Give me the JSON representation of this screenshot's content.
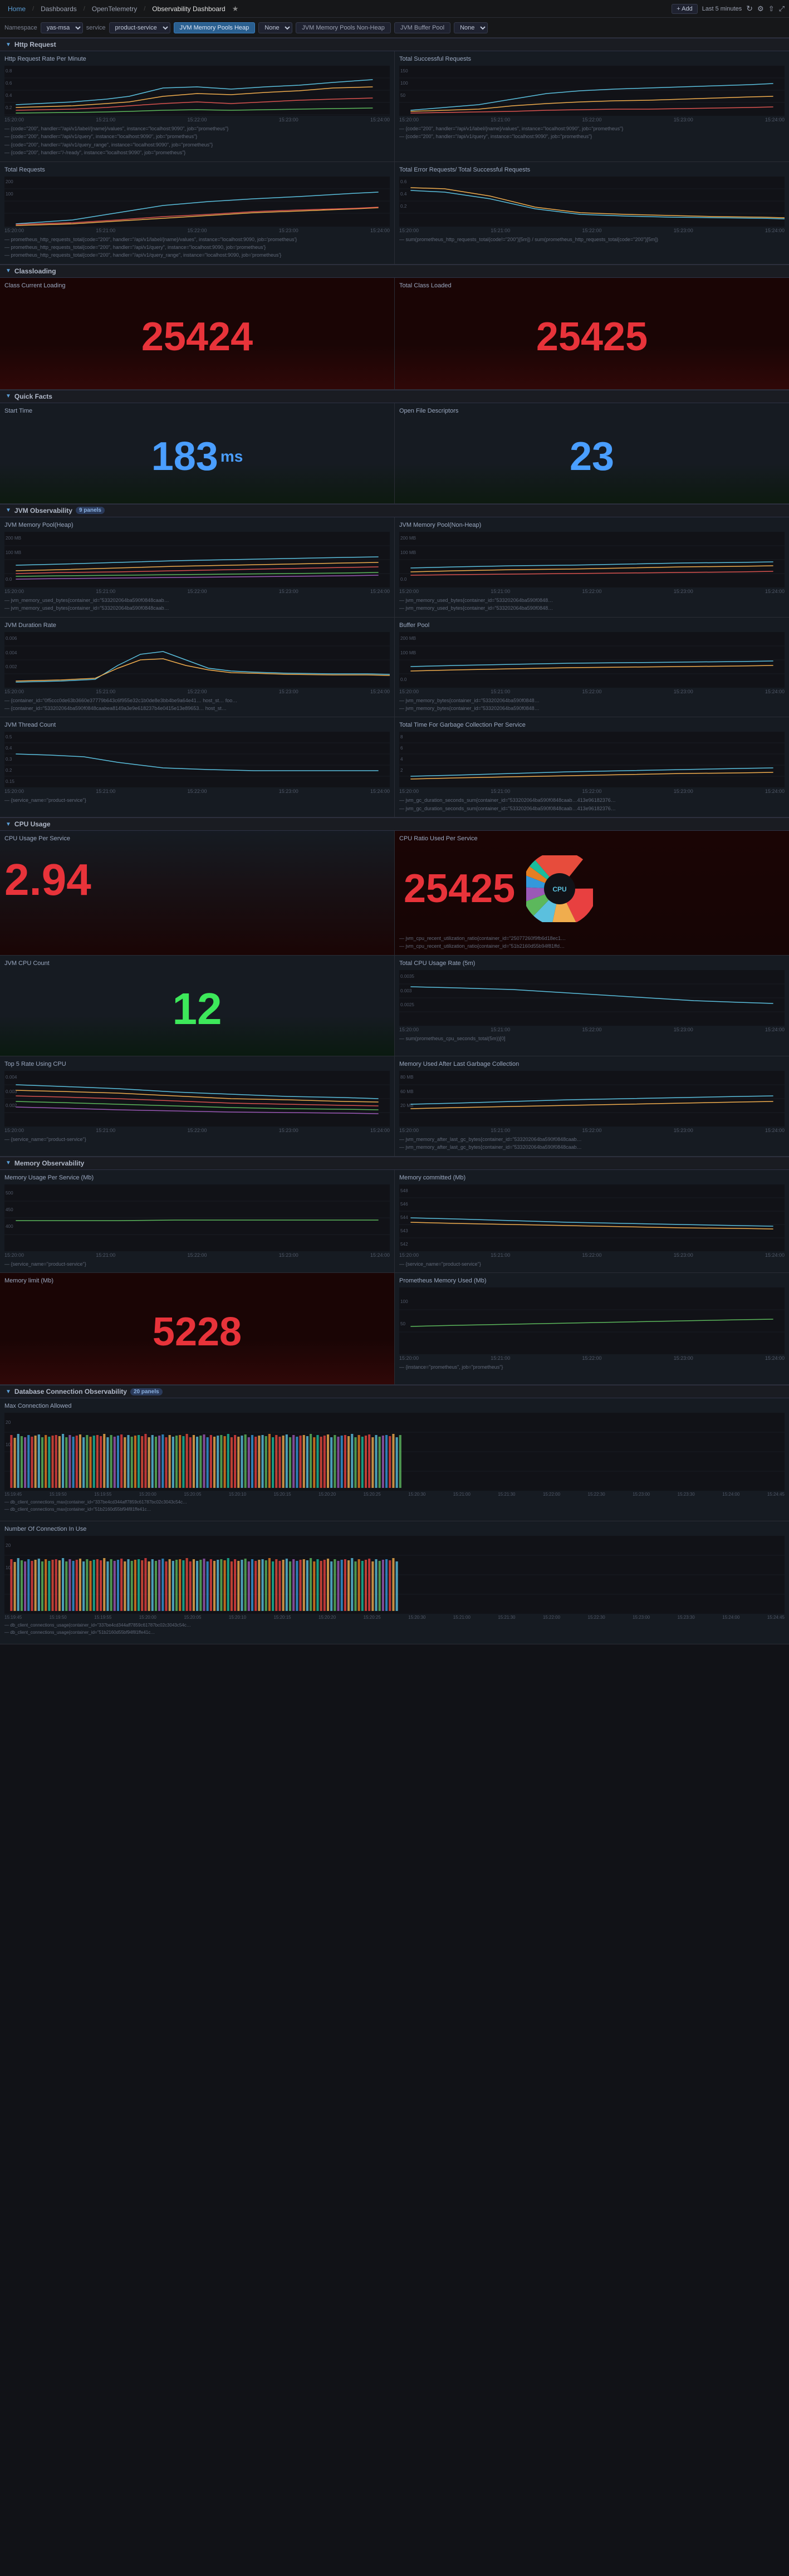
{
  "nav": {
    "home_label": "Home",
    "dashboards_label": "Dashboards",
    "opentelemetry_label": "OpenTelemetry",
    "observability_label": "Observability Dashboard",
    "starred_icon": "★",
    "add_button": "+ Add",
    "last_label": "Last 5 minutes",
    "refresh_icon": "↻",
    "settings_icon": "⚙",
    "share_icon": "⇧",
    "expand_icon": "⤢"
  },
  "toolbar": {
    "namespace_label": "Namespace",
    "namespace_value": "yas-msa ▾",
    "service_label": "service",
    "service_value": "product-service ▾",
    "jvm_heap_tab": "JVM Memory Pools Heap",
    "none1_value": "None ▾",
    "jvm_nonheap_tab": "JVM Memory Pools Non-Heap",
    "buffer_tab": "JVM Buffer Pool",
    "none2_value": "None ▾"
  },
  "sections": {
    "http_request": "Http Request",
    "classloading": "Classloading",
    "quick_facts": "Quick Facts",
    "jvm_observability": "JVM Observability",
    "jvm_count": "9 panels",
    "cpu_usage": "CPU Usage",
    "memory_observability": "Memory Observability",
    "database_connection": "Database Connection Observability",
    "db_count": "20 panels"
  },
  "http_request": {
    "rate_title": "Http Request Rate Per Minute",
    "successful_title": "Total Successful Requests",
    "total_title": "Total Requests",
    "error_title": "Total Error Requests/ Total Successful Requests",
    "y_axis_rate": [
      "0.8",
      "0.6",
      "0.4",
      "0.2"
    ],
    "y_axis_success": [
      "150",
      "100",
      "50"
    ],
    "x_axis_times": [
      "15:20:00",
      "15:21:00",
      "15:22:00",
      "15:23:00",
      "15:24:00"
    ],
    "legend_rate": [
      {
        "color": "#5bc0de",
        "text": "{code='200', handler='/api/v1/label/{name}/values', instance='localhost:9090', job='prometheus'}"
      },
      {
        "color": "#f0ad4e",
        "text": "{code='200', handler='/api/v1/query', instance='localhost:9090', job='prometheus'}"
      },
      {
        "color": "#d9534f",
        "text": "{code='200', handler='/api/v1/query_range', instance='localhost:9090', job='prometheus'}"
      }
    ]
  },
  "classloading": {
    "current_title": "Class Current Loading",
    "total_title": "Total Class Loaded",
    "current_value": "25424",
    "total_value": "25425"
  },
  "quick_facts": {
    "start_title": "Start Time",
    "start_value": "183",
    "start_unit": " ms",
    "open_fd_title": "Open File Descriptors",
    "open_fd_value": "23"
  },
  "jvm_observability": {
    "heap_title": "JVM Memory Pool(Heap)",
    "non_heap_title": "JVM Memory Pool(Non-Heap)",
    "duration_title": "JVM Duration Rate",
    "buffer_title": "Buffer Pool",
    "thread_title": "JVM Thread Count",
    "gc_title": "Total Time For Garbage Collection Per Service",
    "y_heap": [
      "200 MB",
      "100 MB",
      "0.0"
    ],
    "y_nonheap": [
      "200 MB",
      "100 MB",
      "0.0"
    ],
    "y_duration": [
      "0.006",
      "0.004",
      "0.002"
    ],
    "y_buffer": [
      "200 MB",
      "100 MB",
      "0.0"
    ],
    "y_thread": [
      "0.5",
      "0.4",
      "0.3",
      "0.2",
      "0.15"
    ],
    "y_gc": [
      "8",
      "6",
      "4",
      "2"
    ]
  },
  "cpu_usage": {
    "usage_title": "CPU Usage Per Service",
    "usage_value": "2.94",
    "ratio_title": "CPU Ratio Used Per Service",
    "ratio_value": "25425",
    "count_title": "JVM CPU Count",
    "count_value": "12",
    "total_rate_title": "Total CPU Usage Rate (5m)",
    "top5_title": "Top 5 Rate Using CPU",
    "mem_last_gc_title": "Memory Used After Last Garbage Collection",
    "y_total": [
      "0.0035",
      "0.003",
      "0.0025"
    ],
    "y_top5": [
      "0.004",
      "0.003",
      "0.002",
      "0.0025"
    ]
  },
  "memory_observability": {
    "usage_title": "Memory Usage Per Service (Mb)",
    "limit_title": "Memory limit (Mb)",
    "limit_value": "5228",
    "committed_title": "Memory committed (Mb)",
    "prometheus_title": "Prometheus Memory Used (Mb)",
    "y_usage": [
      "500",
      "450",
      "400"
    ],
    "y_committed": [
      "548",
      "546",
      "544",
      "543",
      "542"
    ],
    "y_prometheus": [
      "100",
      "50"
    ]
  },
  "database": {
    "max_conn_title": "Max Connection Allowed",
    "num_conn_title": "Number Of Connection In Use",
    "y_max": [
      "20",
      "10"
    ],
    "y_num": [
      "20",
      "10"
    ]
  },
  "time_labels": {
    "t1": "15:20:00",
    "t2": "15:21:00",
    "t3": "15:22:00",
    "t4": "15:23:00",
    "t5": "15:24:00"
  },
  "pie_colors": [
    "#e84040",
    "#f0ad4e",
    "#5bc0de",
    "#5cb85c",
    "#9b59b6",
    "#3498db",
    "#e67e22",
    "#1abc9c",
    "#e74c3c",
    "#2ecc71",
    "#f39c12",
    "#16a085"
  ]
}
